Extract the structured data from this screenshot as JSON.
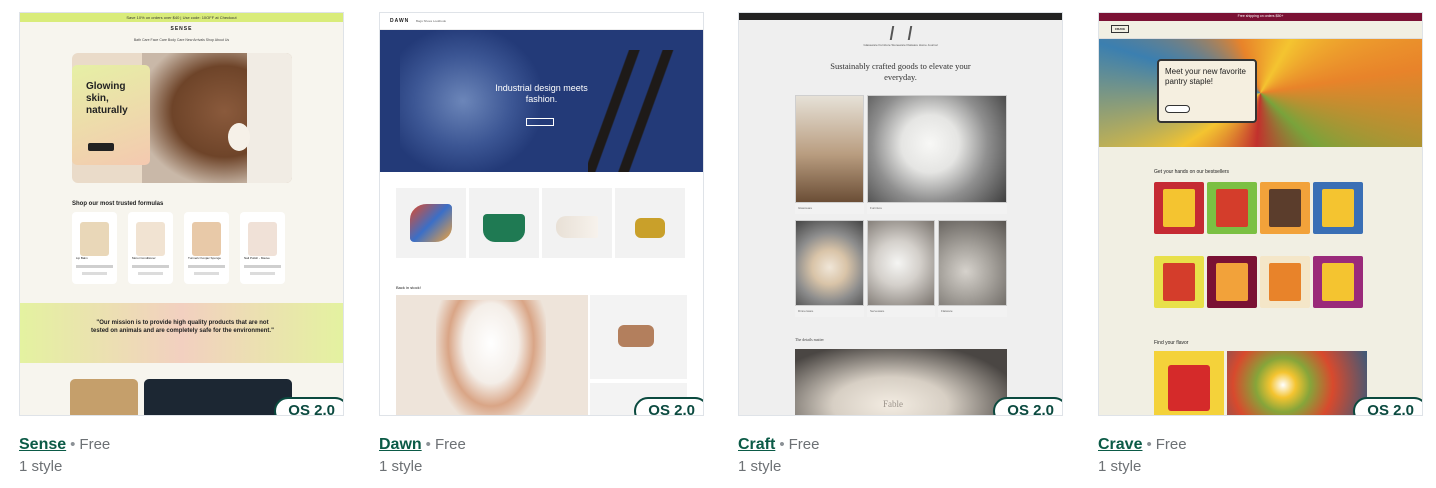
{
  "themes": [
    {
      "name": "Sense",
      "price": "Free",
      "styles": "1 style",
      "badge": "OS 2.0",
      "preview": {
        "announcement": "Save 10% on orders over $40 | Use code: 10OFF at Checkout",
        "logo": "SENSE",
        "nav": "Bath Care   Face Care   Body Care   New Arrivals   Shop   About Us",
        "hero_title": "Glowing skin, naturally",
        "section_title": "Shop our most trusted formulas",
        "products": [
          "Lip Balm",
          "Moroi Conditioner",
          "Turmeric Konjac Sponge",
          "Nail Polish - Mauve"
        ],
        "quote": "\"Our mission is to provide high quality products that are not tested on animals and are completely safe for the environment.\""
      }
    },
    {
      "name": "Dawn",
      "price": "Free",
      "styles": "1 style",
      "badge": "OS 2.0",
      "preview": {
        "logo": "DAWN",
        "nav": "Bags   Shoes   Lookbook",
        "hero_title": "Industrial design meets fashion.",
        "section_title": "Back in stock!"
      }
    },
    {
      "name": "Craft",
      "price": "Free",
      "styles": "1 style",
      "badge": "OS 2.0",
      "preview": {
        "nav": "Glassware   Furniture   Stoneware   Flatware   Home   Journal",
        "hero_title": "Sustainably crafted goods to elevate your everyday.",
        "tiles": [
          "Glassware",
          "Furniture",
          "Dinnerware",
          "Serveware",
          "Flatware"
        ],
        "section_title": "The details matter",
        "plate_text": "Fable"
      }
    },
    {
      "name": "Crave",
      "price": "Free",
      "styles": "1 style",
      "badge": "OS 2.0",
      "preview": {
        "logo": "CRAVE",
        "announcement": "Free shipping on orders $50+",
        "hero_title": "Meet your new favorite pantry staple!",
        "section_title": "Get your hands on our bestsellers",
        "section_title_2": "Find your flavor"
      }
    }
  ],
  "colors": {
    "link": "#0b5a46",
    "badge_border": "#0b4a3f",
    "muted": "#6d7175"
  }
}
